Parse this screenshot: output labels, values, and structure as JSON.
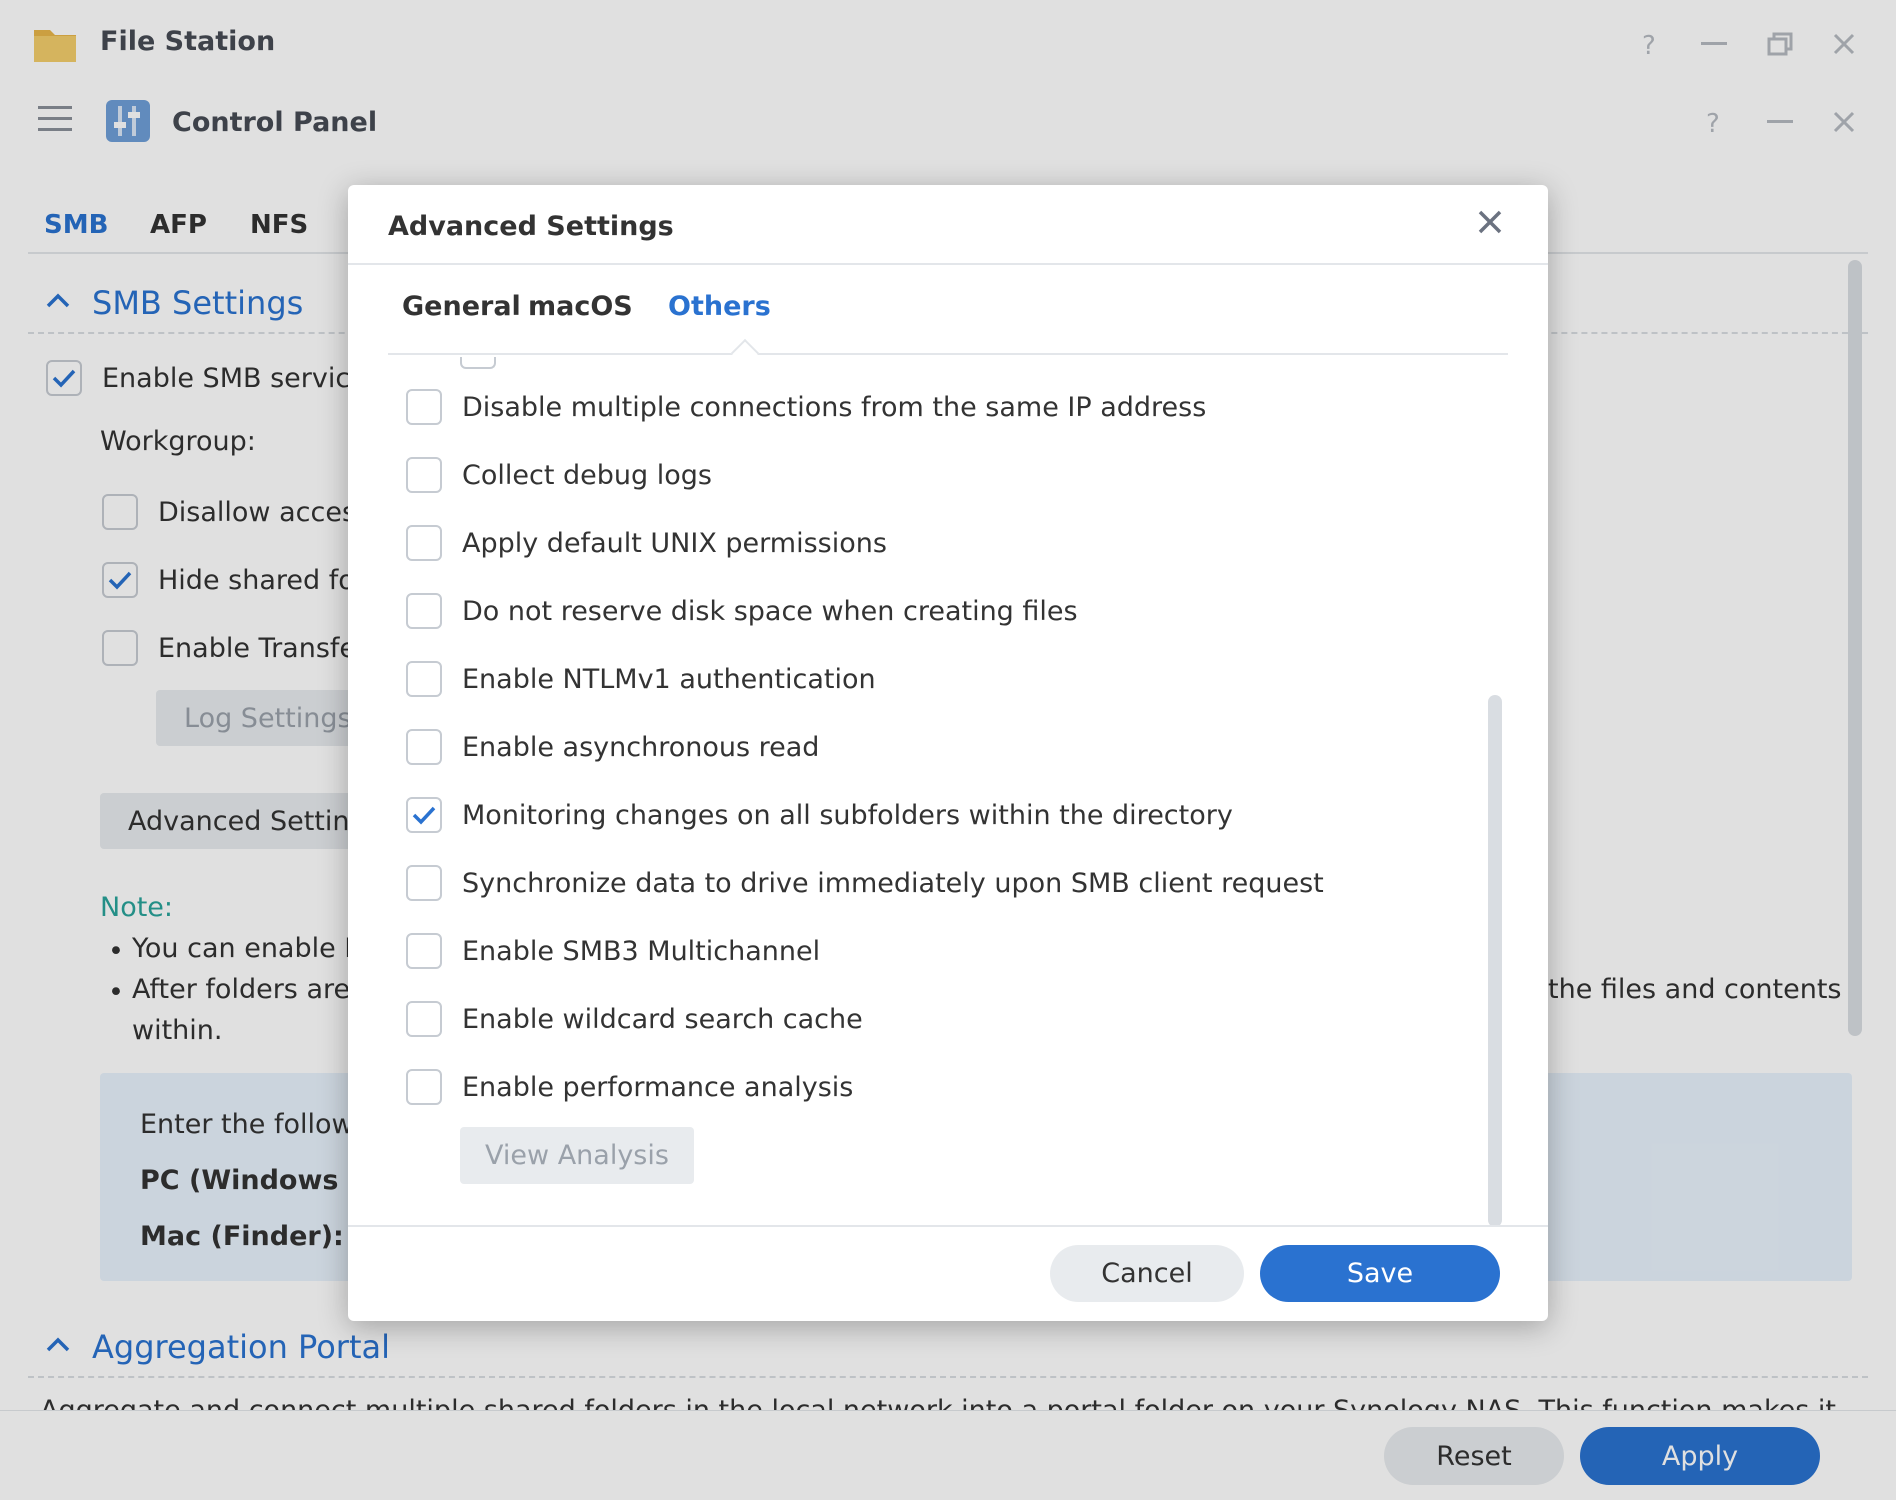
{
  "file_station": {
    "title": "File Station"
  },
  "control_panel": {
    "title": "Control Panel",
    "tabs": [
      "SMB",
      "AFP",
      "NFS"
    ],
    "active_tab": "SMB",
    "smb_section": {
      "title": "SMB Settings",
      "enable_smb": {
        "label": "Enable SMB service",
        "checked": true
      },
      "workgroup_label": "Workgroup:",
      "disallow_access": {
        "label": "Disallow access",
        "checked": false
      },
      "hide_shared": {
        "label": "Hide shared fo",
        "checked": true
      },
      "enable_transfer": {
        "label": "Enable Transfe",
        "checked": false
      },
      "log_settings_button": "Log Settings",
      "advanced_settings_button": "Advanced Settings"
    },
    "note": {
      "label": "Note:",
      "bullets": [
        "You can enable F",
        "After folders are"
      ],
      "bullet2_tail": "the files and contents",
      "bullet2_wrap": "within."
    },
    "info_box": {
      "line1": "Enter the follow",
      "pc_label": "PC (Windows I",
      "mac_label": "Mac (Finder):"
    },
    "aggregation_section": {
      "title": "Aggregation Portal",
      "description": "Aggregate and connect multiple shared folders in the local network into a portal folder on your Synology NAS. This function makes it"
    },
    "footer": {
      "reset": "Reset",
      "apply": "Apply"
    }
  },
  "modal": {
    "title": "Advanced Settings",
    "tabs": [
      "General",
      "macOS",
      "Others"
    ],
    "active_tab": "Others",
    "options": [
      {
        "label": "Disable multiple connections from the same IP address",
        "checked": false
      },
      {
        "label": "Collect debug logs",
        "checked": false
      },
      {
        "label": "Apply default UNIX permissions",
        "checked": false
      },
      {
        "label": "Do not reserve disk space when creating files",
        "checked": false
      },
      {
        "label": "Enable NTLMv1 authentication",
        "checked": false
      },
      {
        "label": "Enable asynchronous read",
        "checked": false
      },
      {
        "label": "Monitoring changes on all subfolders within the directory",
        "checked": true
      },
      {
        "label": "Synchronize data to drive immediately upon SMB client request",
        "checked": false
      },
      {
        "label": "Enable SMB3 Multichannel",
        "checked": false
      },
      {
        "label": "Enable wildcard search cache",
        "checked": false
      },
      {
        "label": "Enable performance analysis",
        "checked": false
      }
    ],
    "view_analysis_button": "View Analysis",
    "cancel": "Cancel",
    "save": "Save"
  },
  "colors": {
    "accent": "#2a72d0",
    "note_teal": "#2aa39a",
    "info_bg": "#e8f2fc"
  }
}
